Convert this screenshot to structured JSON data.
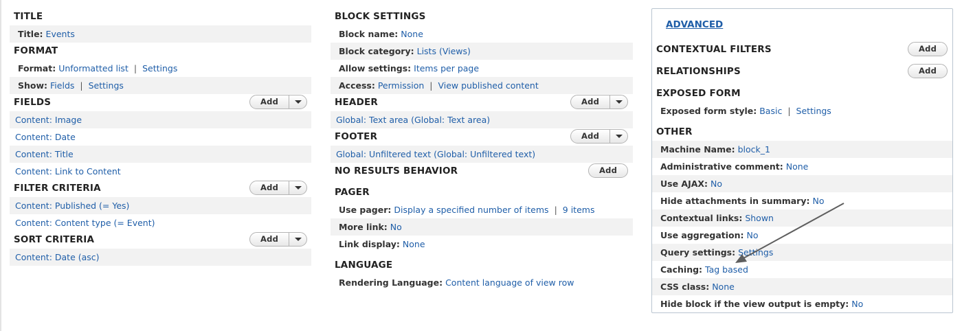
{
  "title_section": {
    "heading": "TITLE",
    "rows": [
      {
        "label": "Title:",
        "value": "Events"
      }
    ]
  },
  "format_section": {
    "heading": "FORMAT",
    "format_label": "Format:",
    "format_value": "Unformatted list",
    "format_settings": "Settings",
    "show_label": "Show:",
    "show_value": "Fields",
    "show_settings": "Settings",
    "separator": "|"
  },
  "fields_section": {
    "heading": "FIELDS",
    "add_label": "Add",
    "items": [
      "Content: Image",
      "Content: Date",
      "Content: Title",
      "Content: Link to Content"
    ]
  },
  "filter_section": {
    "heading": "FILTER CRITERIA",
    "add_label": "Add",
    "items": [
      "Content: Published (= Yes)",
      "Content: Content type (= Event)"
    ]
  },
  "sort_section": {
    "heading": "SORT CRITERIA",
    "add_label": "Add",
    "items": [
      "Content: Date (asc)"
    ]
  },
  "block_settings": {
    "heading": "BLOCK SETTINGS",
    "block_name_label": "Block name:",
    "block_name_value": "None",
    "block_category_label": "Block category:",
    "block_category_value": "Lists (Views)",
    "allow_settings_label": "Allow settings:",
    "allow_settings_value": "Items per page",
    "access_label": "Access:",
    "access_value": "Permission",
    "access_detail": "View published content"
  },
  "header_section": {
    "heading": "HEADER",
    "add_label": "Add",
    "items": [
      "Global: Text area (Global: Text area)"
    ]
  },
  "footer_section": {
    "heading": "FOOTER",
    "add_label": "Add",
    "items": [
      "Global: Unfiltered text (Global: Unfiltered text)"
    ]
  },
  "no_results_section": {
    "heading": "NO RESULTS BEHAVIOR",
    "add_label": "Add"
  },
  "pager_section": {
    "heading": "PAGER",
    "use_pager_label": "Use pager:",
    "use_pager_value": "Display a specified number of items",
    "use_pager_count": "9 items",
    "more_link_label": "More link:",
    "more_link_value": "No",
    "link_display_label": "Link display:",
    "link_display_value": "None"
  },
  "language_section": {
    "heading": "LANGUAGE",
    "rendering_label": "Rendering Language:",
    "rendering_value": "Content language of view row"
  },
  "advanced": {
    "link_label": "ADVANCED",
    "contextual_filters_heading": "CONTEXTUAL FILTERS",
    "contextual_filters_add": "Add",
    "relationships_heading": "RELATIONSHIPS",
    "relationships_add": "Add",
    "exposed_form_heading": "EXPOSED FORM",
    "exposed_style_label": "Exposed form style:",
    "exposed_style_value": "Basic",
    "exposed_settings": "Settings",
    "other_heading": "OTHER",
    "other_rows": [
      {
        "label": "Machine Name:",
        "value": "block_1"
      },
      {
        "label": "Administrative comment:",
        "value": "None"
      },
      {
        "label": "Use AJAX:",
        "value": "No"
      },
      {
        "label": "Hide attachments in summary:",
        "value": "No"
      },
      {
        "label": "Contextual links:",
        "value": "Shown"
      },
      {
        "label": "Use aggregation:",
        "value": "No"
      },
      {
        "label": "Query settings:",
        "value": "Settings"
      },
      {
        "label": "Caching:",
        "value": "Tag based"
      },
      {
        "label": "CSS class:",
        "value": "None"
      },
      {
        "label": "Hide block if the view output is empty:",
        "value": "No"
      }
    ]
  },
  "colors": {
    "link": "#1f5ea8",
    "stripe": "#f2f2f2",
    "panel_border": "#b9c5d0",
    "arrow": "#5e5e5e"
  }
}
